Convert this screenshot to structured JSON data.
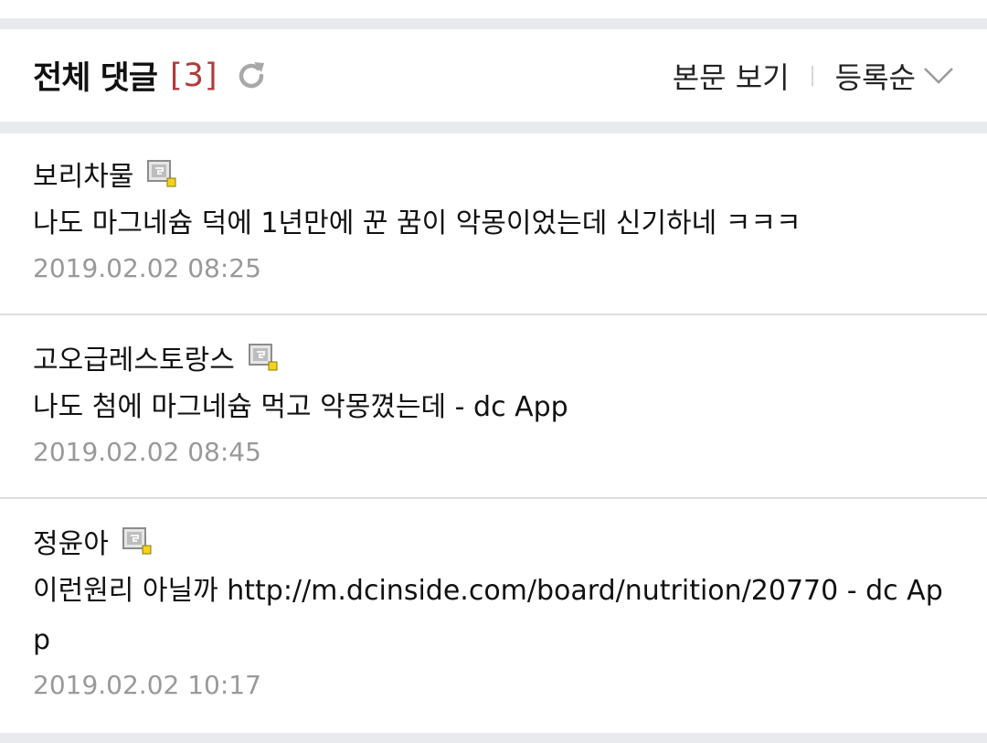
{
  "header": {
    "title": "전체 댓글",
    "count": "[3]",
    "view_body_label": "본문 보기",
    "sort_label": "등록순",
    "accent_color": "#b33a3a"
  },
  "comments": [
    {
      "author": "보리차물",
      "content": "나도 마그네슘 덕에 1년만에 꾼 꿈이 악몽이었는데 신기하네 ㅋㅋㅋ",
      "date": "2019.02.02 08:25"
    },
    {
      "author": "고오급레스토랑스",
      "content": "나도 첨에 마그네슘 먹고 악몽꼈는데 - dc App",
      "date": "2019.02.02 08:45"
    },
    {
      "author": "정윤아",
      "content": "이런원리 아닐까 http://m.dcinside.com/board/nutrition/20770 - dc App",
      "date": "2019.02.02 10:17"
    }
  ]
}
